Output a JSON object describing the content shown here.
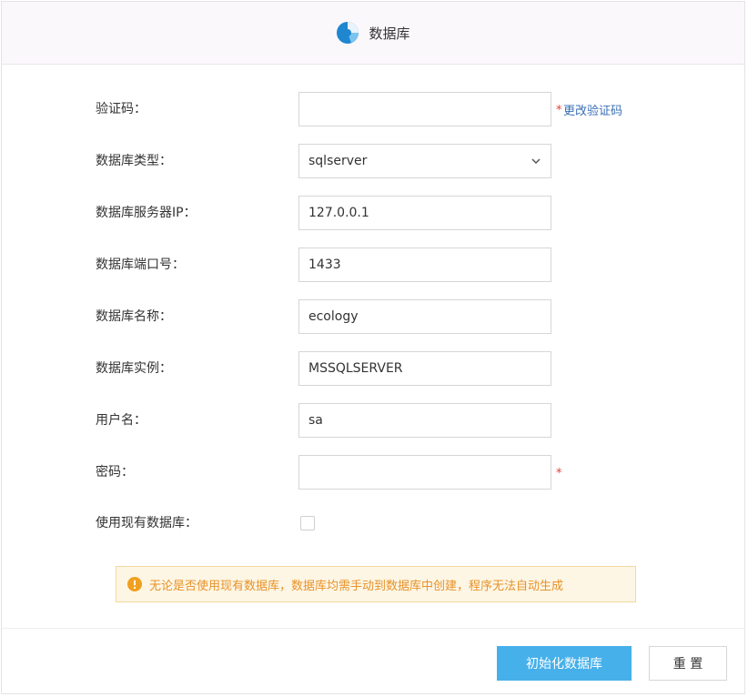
{
  "header": {
    "title": "数据库",
    "icon": "database-pie-icon"
  },
  "form": {
    "verification_code": {
      "label": "验证码：",
      "value": "",
      "change_link": "更改验证码",
      "required_mark": "*"
    },
    "db_type": {
      "label": "数据库类型：",
      "value": "sqlserver"
    },
    "server_ip": {
      "label": "数据库服务器IP：",
      "value": "127.0.0.1"
    },
    "port": {
      "label": "数据库端口号：",
      "value": "1433"
    },
    "db_name": {
      "label": "数据库名称：",
      "value": "ecology"
    },
    "instance": {
      "label": "数据库实例：",
      "value": "MSSQLSERVER"
    },
    "username": {
      "label": "用户名：",
      "value": "sa"
    },
    "password": {
      "label": "密码：",
      "value": "",
      "required_mark": "*"
    },
    "use_existing": {
      "label": "使用现有数据库：",
      "checked": false
    }
  },
  "notice": {
    "text": "无论是否使用现有数据库，数据库均需手动到数据库中创建，程序无法自动生成",
    "icon": "warning-icon"
  },
  "buttons": {
    "init": "初始化数据库",
    "reset": "重 置"
  },
  "colors": {
    "accent": "#46b0ea",
    "link": "#3a6fb5",
    "required": "#e0403a",
    "warning": "#e8922a"
  }
}
